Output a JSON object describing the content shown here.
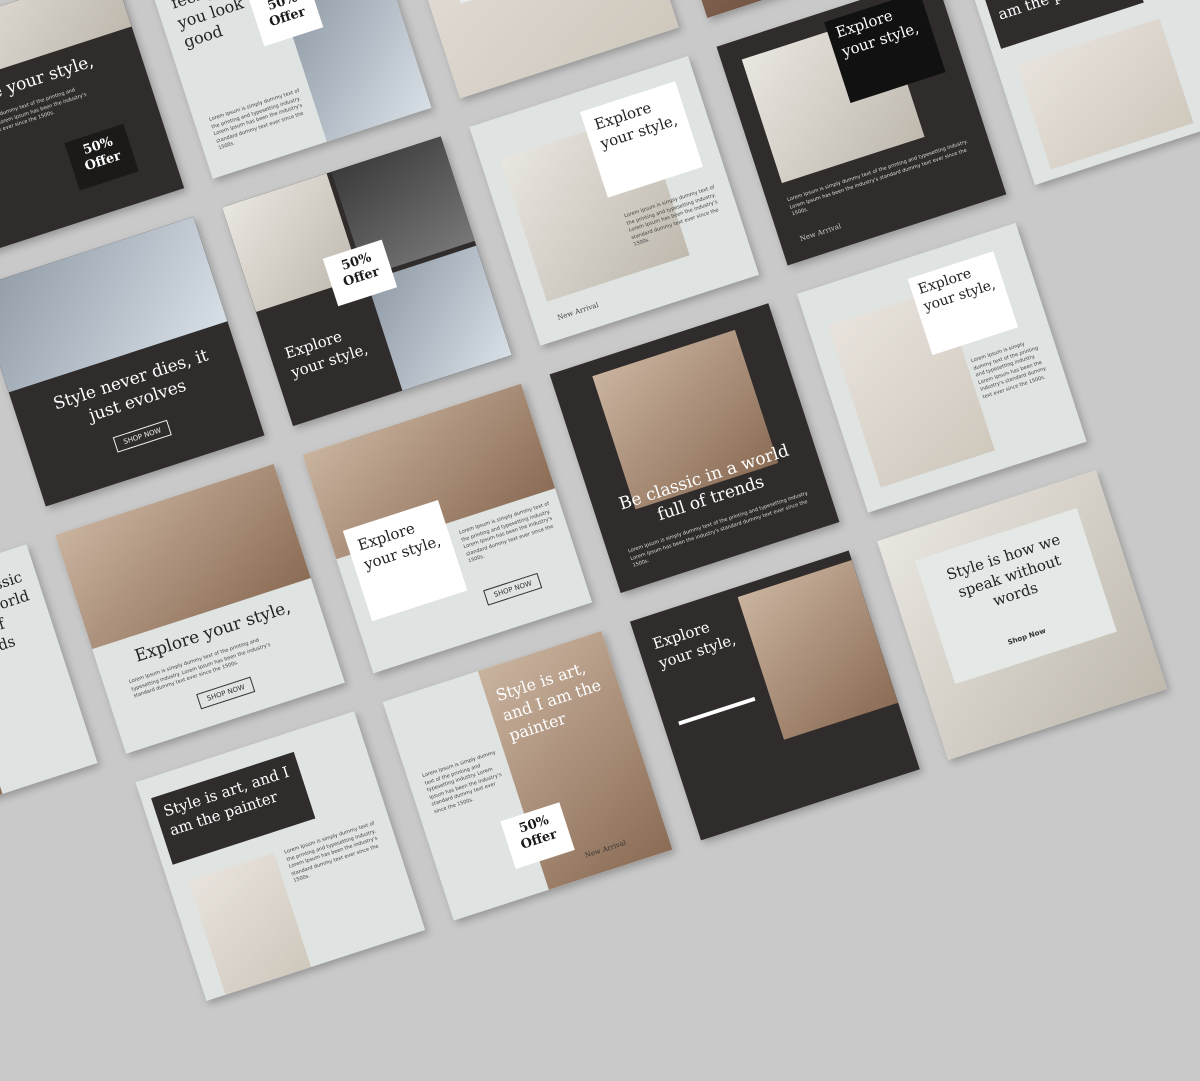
{
  "headlines": {
    "explore_inline": "Explore your style,",
    "explore_stacked": "Explore your style,",
    "feel_good": "When you feel good, you look good",
    "never_dies": "Style never dies, it just evolves",
    "classic": "Be classic in a world full of trends",
    "art": "Style is art, and I am the painter",
    "speak": "Style is how we speak without words",
    "world": "world"
  },
  "offer": {
    "line1": "50%",
    "line2": "Offer"
  },
  "buttons": {
    "shop_now_caps": "SHOP NOW",
    "shop_now": "Shop Now"
  },
  "tags": {
    "new_arrival": "New Arrival"
  },
  "body_copy": "Lorem Ipsum is simply dummy text of the printing and typesetting industry. Lorem Ipsum has been the industry's standard dummy text ever since the 1500s.",
  "colors": {
    "dark_panel": "#2f2c2b",
    "light_panel": "#dfe3e1",
    "background": "#c9c9c9"
  }
}
